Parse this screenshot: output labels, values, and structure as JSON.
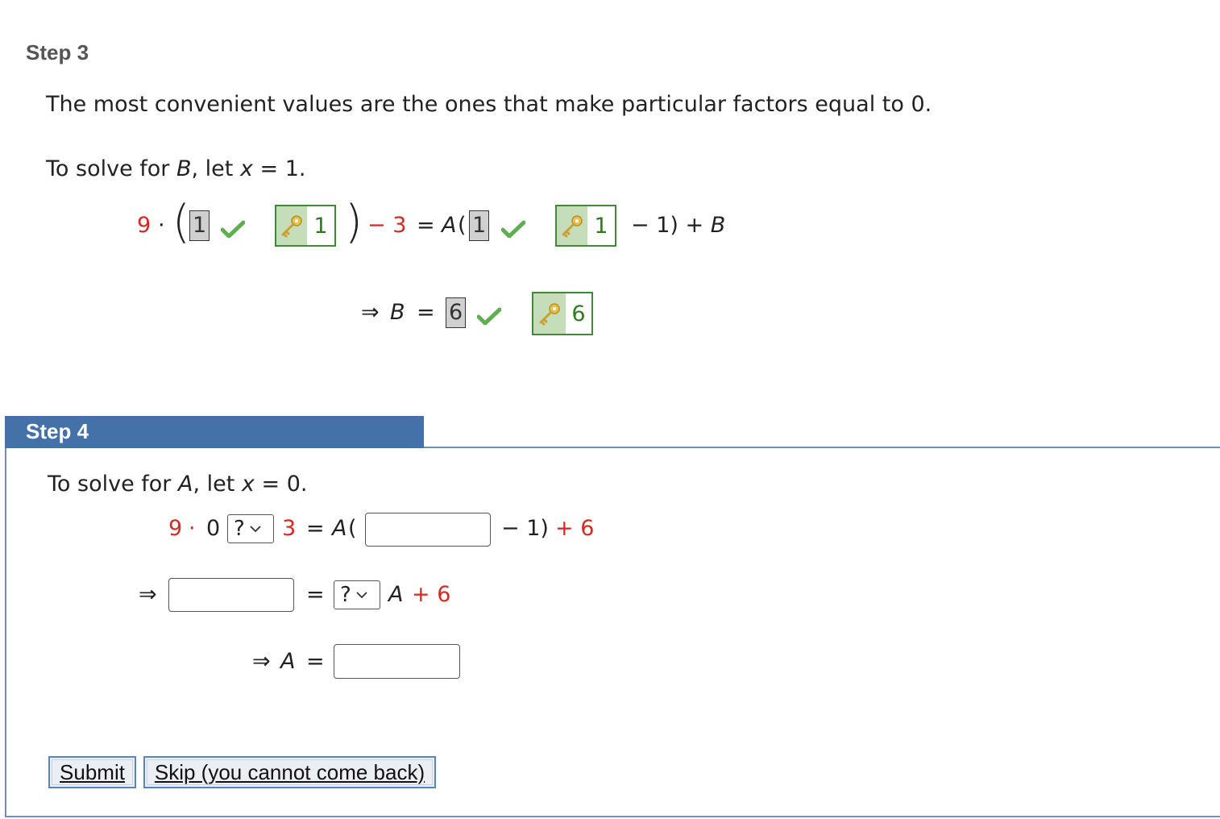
{
  "step3": {
    "heading": "Step 3",
    "intro": "The most convenient values are the ones that make particular factors equal to 0.",
    "solve_prefix": "To solve for ",
    "solve_var": "B",
    "solve_mid": ", let ",
    "solve_x": "x",
    "solve_rest": " = 1.",
    "eq1": {
      "coef": "9",
      "dot": "·",
      "given1": "1",
      "key1": "1",
      "minus3": "− 3",
      "eq": "=",
      "A": "A",
      "open_paren": "(",
      "given2": "1",
      "key2": "1",
      "tail": "− 1) + ",
      "B": "B"
    },
    "eq2": {
      "arrow": "⇒",
      "B": "B",
      "eq": "=",
      "given": "6",
      "key": "6"
    }
  },
  "step4": {
    "heading": "Step 4",
    "solve_prefix": "To solve for ",
    "solve_var": "A",
    "solve_mid": ", let ",
    "solve_x": "x",
    "solve_rest": " = 0.",
    "eq1": {
      "lhs_coef": "9",
      "dot": "·",
      "zero": "0",
      "dropdown": "?",
      "three": "3",
      "eq": "=",
      "A": "A",
      "open_paren": "(",
      "input_value": "",
      "tail_plain": "− 1)",
      "tail_red": "+ 6"
    },
    "eq2": {
      "arrow": "⇒",
      "input_value": "",
      "eq": "=",
      "dropdown": "?",
      "A": "A",
      "tail_red": "+ 6"
    },
    "eq3": {
      "arrow": "⇒",
      "A": "A",
      "eq": "=",
      "input_value": ""
    },
    "buttons": {
      "submit": "Submit",
      "skip": "Skip (you cannot come back)"
    }
  },
  "icons": {
    "check": "checkmark-icon",
    "key": "key-icon",
    "chevron": "chevron-down-icon"
  },
  "colors": {
    "banner": "#4471a8",
    "accent_red": "#d8281f",
    "correct_green": "#2f7a1f"
  }
}
